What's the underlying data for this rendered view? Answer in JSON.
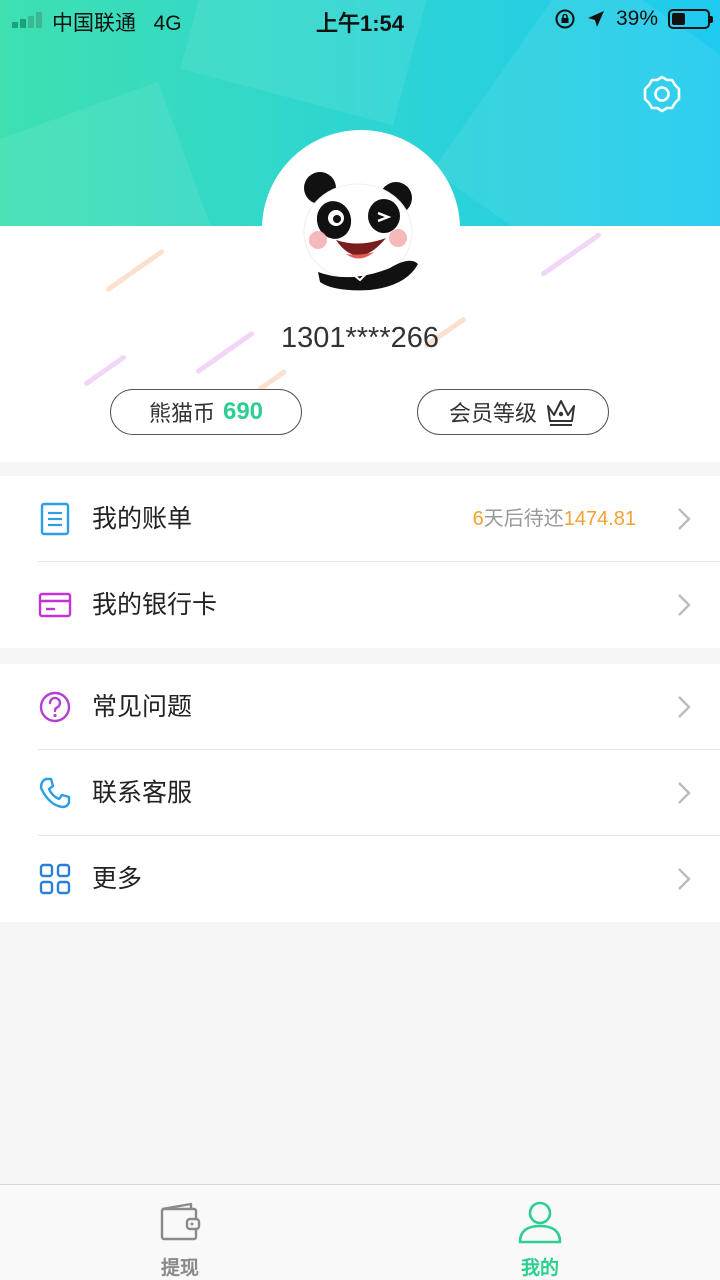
{
  "status_bar": {
    "carrier": "中国联通",
    "network": "4G",
    "time": "上午1:54",
    "battery_percent": "39%",
    "battery_level": 0.39
  },
  "profile": {
    "phone_masked": "1301****266",
    "coins_label": "熊猫币",
    "coins_value": "690",
    "member_label": "会员等级"
  },
  "menu_primary": [
    {
      "label": "我的账单",
      "icon": "bill-icon",
      "extra_days": "6",
      "extra_text": "天后待还",
      "extra_amount": "1474.81"
    },
    {
      "label": "我的银行卡",
      "icon": "bank-card-icon"
    }
  ],
  "menu_secondary": [
    {
      "label": "常见问题",
      "icon": "question-icon"
    },
    {
      "label": "联系客服",
      "icon": "phone-icon"
    },
    {
      "label": "更多",
      "icon": "grid-icon"
    }
  ],
  "tabbar": {
    "tabs": [
      {
        "label": "提现",
        "icon": "wallet-icon",
        "active": false
      },
      {
        "label": "我的",
        "icon": "user-icon",
        "active": true
      }
    ]
  },
  "colors": {
    "accent_green": "#2ccf8f",
    "accent_orange": "#f5a131",
    "header_start": "#3ee0b0",
    "header_end": "#1ecaf0",
    "tab_active": "#2ccf8f",
    "tab_inactive": "#8a8a8a"
  }
}
